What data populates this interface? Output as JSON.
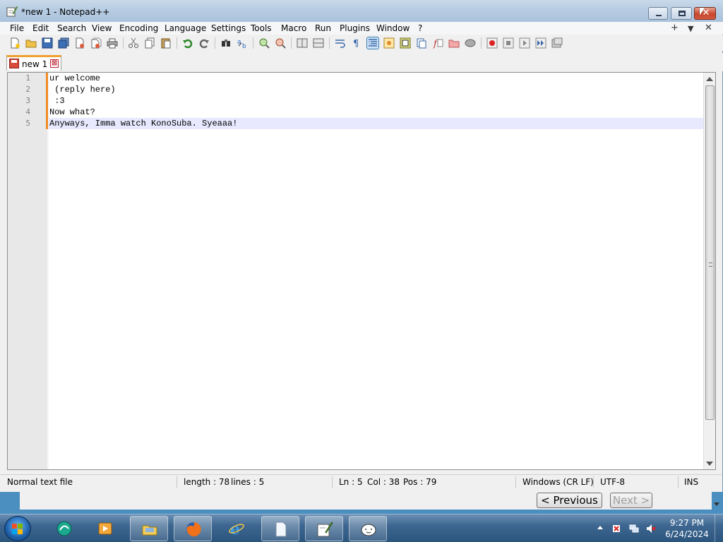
{
  "window": {
    "title": "*new 1 - Notepad++",
    "close_symbol": "✕"
  },
  "menu": {
    "items": [
      "File",
      "Edit",
      "Search",
      "View",
      "Encoding",
      "Language",
      "Settings",
      "Tools",
      "Macro",
      "Run",
      "Plugins",
      "Window",
      "?"
    ],
    "right_controls": [
      "+",
      "▼",
      "✕"
    ]
  },
  "toolbar": {
    "icons": [
      "new-file-icon",
      "open-file-icon",
      "save-icon",
      "save-all-icon",
      "close-icon",
      "close-all-icon",
      "print-icon",
      "cut-icon",
      "copy-icon",
      "paste-icon",
      "undo-icon",
      "redo-icon",
      "find-icon",
      "replace-icon",
      "zoom-in-icon",
      "zoom-out-icon",
      "sync-vertical-icon",
      "sync-horizontal-icon",
      "word-wrap-icon",
      "show-all-chars-icon",
      "indent-guide-icon",
      "user-lang-icon",
      "doc-map-icon",
      "doc-list-icon",
      "function-list-icon",
      "folder-workspace-icon",
      "monitoring-icon",
      "record-macro-icon",
      "stop-macro-icon",
      "play-macro-icon",
      "run-macro-multiple-icon",
      "save-macro-icon"
    ]
  },
  "tabs": [
    {
      "label": "new 1",
      "close": "⊠"
    }
  ],
  "editor": {
    "lines": [
      {
        "num": "1",
        "text": "ur welcome"
      },
      {
        "num": "2",
        "text": " (reply here)"
      },
      {
        "num": "3",
        "text": " :3"
      },
      {
        "num": "4",
        "text": "Now what?"
      },
      {
        "num": "5",
        "text": "Anyways, Imma watch KonoSuba. Syeaaa!"
      }
    ],
    "current_line": 5
  },
  "status": {
    "file_type": "Normal text file",
    "length": "length : 78",
    "lines": "lines : 5",
    "ln": "Ln : 5",
    "col": "Col : 38",
    "pos": "Pos : 79",
    "eol": "Windows (CR LF)",
    "encoding": "UTF-8",
    "mode": "INS"
  },
  "behind": {
    "prev_label": "< Previous",
    "next_label": "Next >"
  },
  "taskbar": {
    "apps": [
      "start-orb",
      "app-icon-teal",
      "media-player-icon",
      "file-explorer-icon",
      "firefox-icon",
      "internet-explorer-icon",
      "blank-document-icon",
      "notepadpp-icon",
      "avatar-face-icon"
    ],
    "clock_time": "9:27 PM",
    "clock_date": "6/24/2024"
  }
}
